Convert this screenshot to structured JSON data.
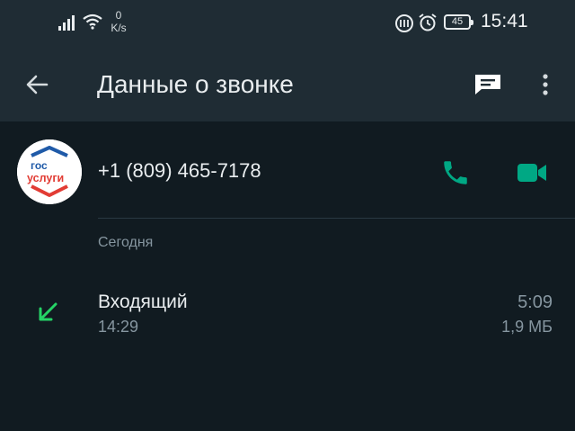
{
  "status_bar": {
    "net_speed_value": "0",
    "net_speed_unit": "K/s",
    "battery_level": "45",
    "time": "15:41"
  },
  "app_bar": {
    "title": "Данные о звонке",
    "icons": [
      "back-arrow-icon",
      "message-icon",
      "more-vert-icon"
    ]
  },
  "contact": {
    "avatar_line1": "гос",
    "avatar_line2": "услуги",
    "phone_number": "+1 (809) 465-7178",
    "actions": [
      "voice-call-icon",
      "video-call-icon"
    ]
  },
  "section": {
    "header": "Сегодня"
  },
  "call_log": [
    {
      "type": "Входящий",
      "time": "14:29",
      "duration": "5:09",
      "size": "1,9 МБ",
      "icon": "incoming-call-arrow-icon"
    }
  ],
  "colors": {
    "background": "#111b21",
    "bar": "#1f2c34",
    "accent": "#00a884",
    "incoming_arrow": "#25d366",
    "primary_text": "#e9edef",
    "secondary_text": "#8696a0",
    "avatar_blue": "#1f5aa8",
    "avatar_red": "#e23c34"
  }
}
